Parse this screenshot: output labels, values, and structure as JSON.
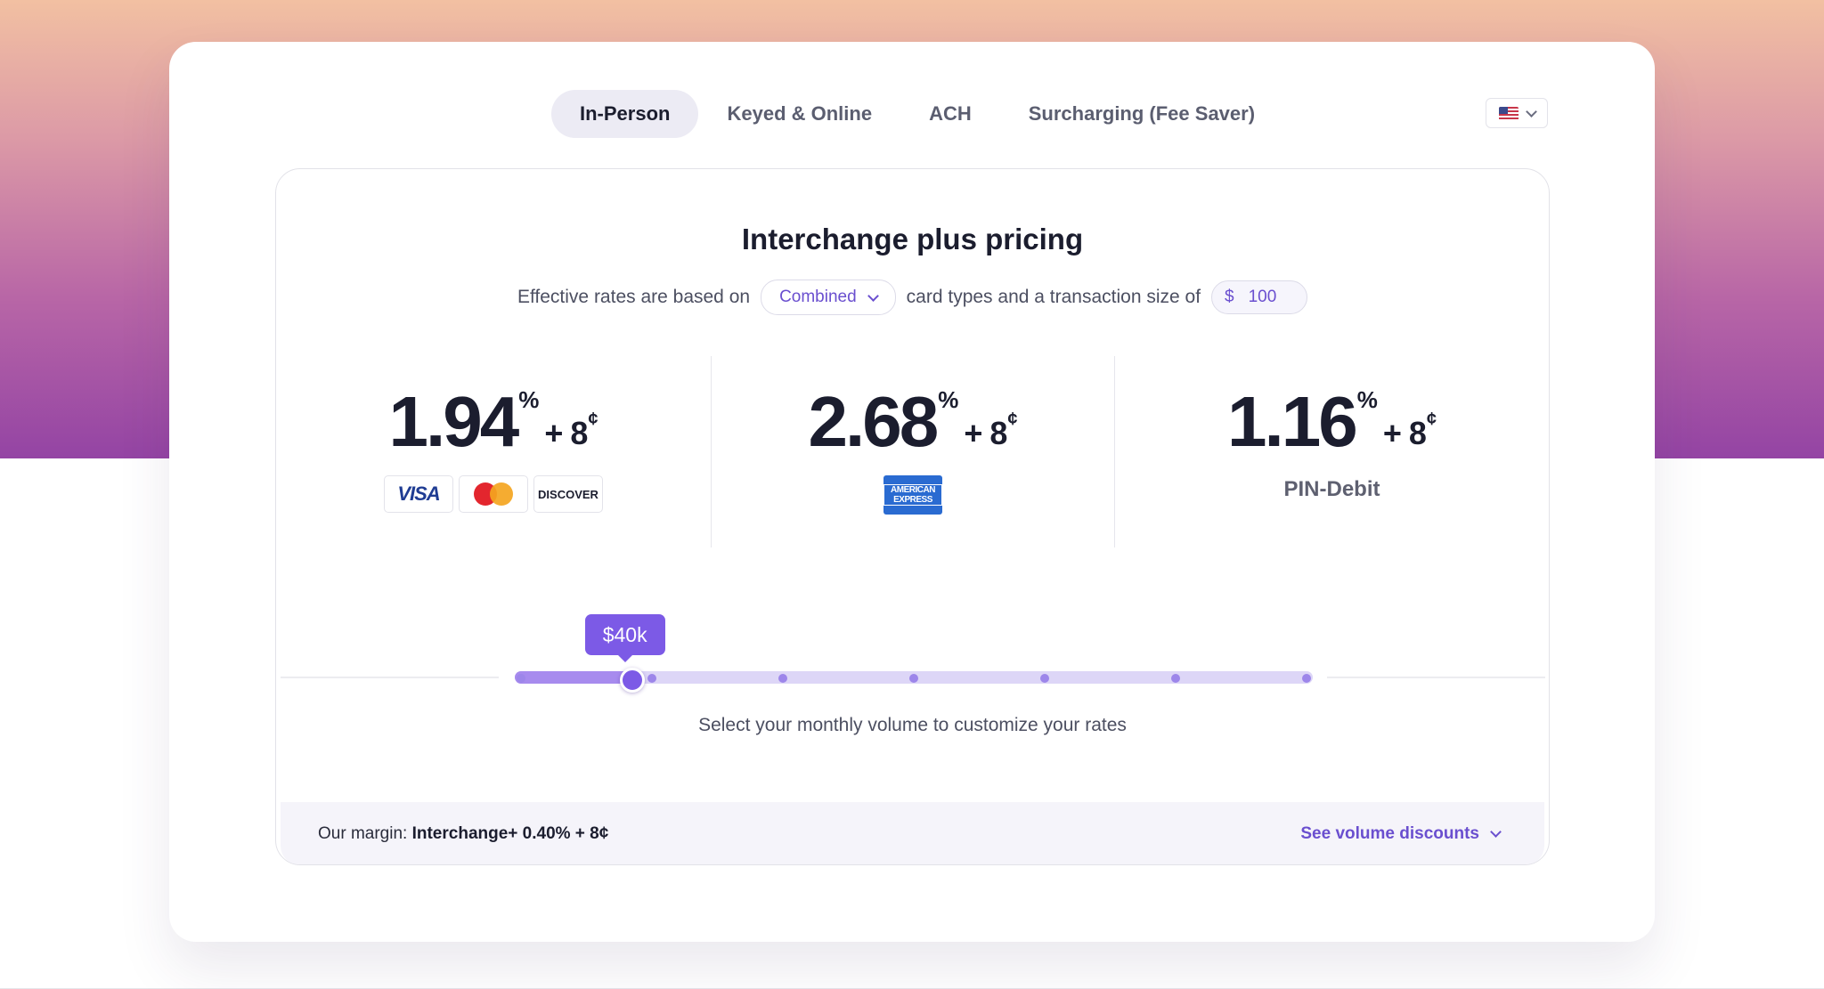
{
  "tabs": [
    {
      "label": "In-Person",
      "active": true
    },
    {
      "label": "Keyed & Online",
      "active": false
    },
    {
      "label": "ACH",
      "active": false
    },
    {
      "label": "Surcharging (Fee Saver)",
      "active": false
    }
  ],
  "region_select": {
    "flag_icon": "us-flag-icon"
  },
  "pricing": {
    "title": "Interchange plus pricing",
    "rates_prefix": "Effective rates are based on",
    "card_type_selected": "Combined",
    "rates_middle": "card types and a transaction size of",
    "currency_symbol": "$",
    "transaction_size": "100"
  },
  "rates": [
    {
      "rate": "1.94",
      "percent_sign": "%",
      "plus": "+",
      "cents": "8",
      "cent_sign": "¢",
      "cards": [
        "VISA",
        "mastercard",
        "DISCOVER"
      ]
    },
    {
      "rate": "2.68",
      "percent_sign": "%",
      "plus": "+",
      "cents": "8",
      "cent_sign": "¢",
      "cards": [
        "AMERICAN EXPRESS"
      ]
    },
    {
      "rate": "1.16",
      "percent_sign": "%",
      "plus": "+",
      "cents": "8",
      "cent_sign": "¢",
      "label": "PIN-Debit"
    }
  ],
  "volume_slider": {
    "value_label": "$40k",
    "steps": 6,
    "value_fraction": 0.138,
    "caption": "Select your monthly volume to customize your rates"
  },
  "margin": {
    "prefix": "Our margin:",
    "value": "Interchange+ 0.40% + 8¢",
    "link": "See volume discounts"
  },
  "colors": {
    "accent": "#7c5ae6",
    "link": "#6a4fcf",
    "gradient_top": "#f2c0a2",
    "gradient_bottom": "#9444a4"
  }
}
